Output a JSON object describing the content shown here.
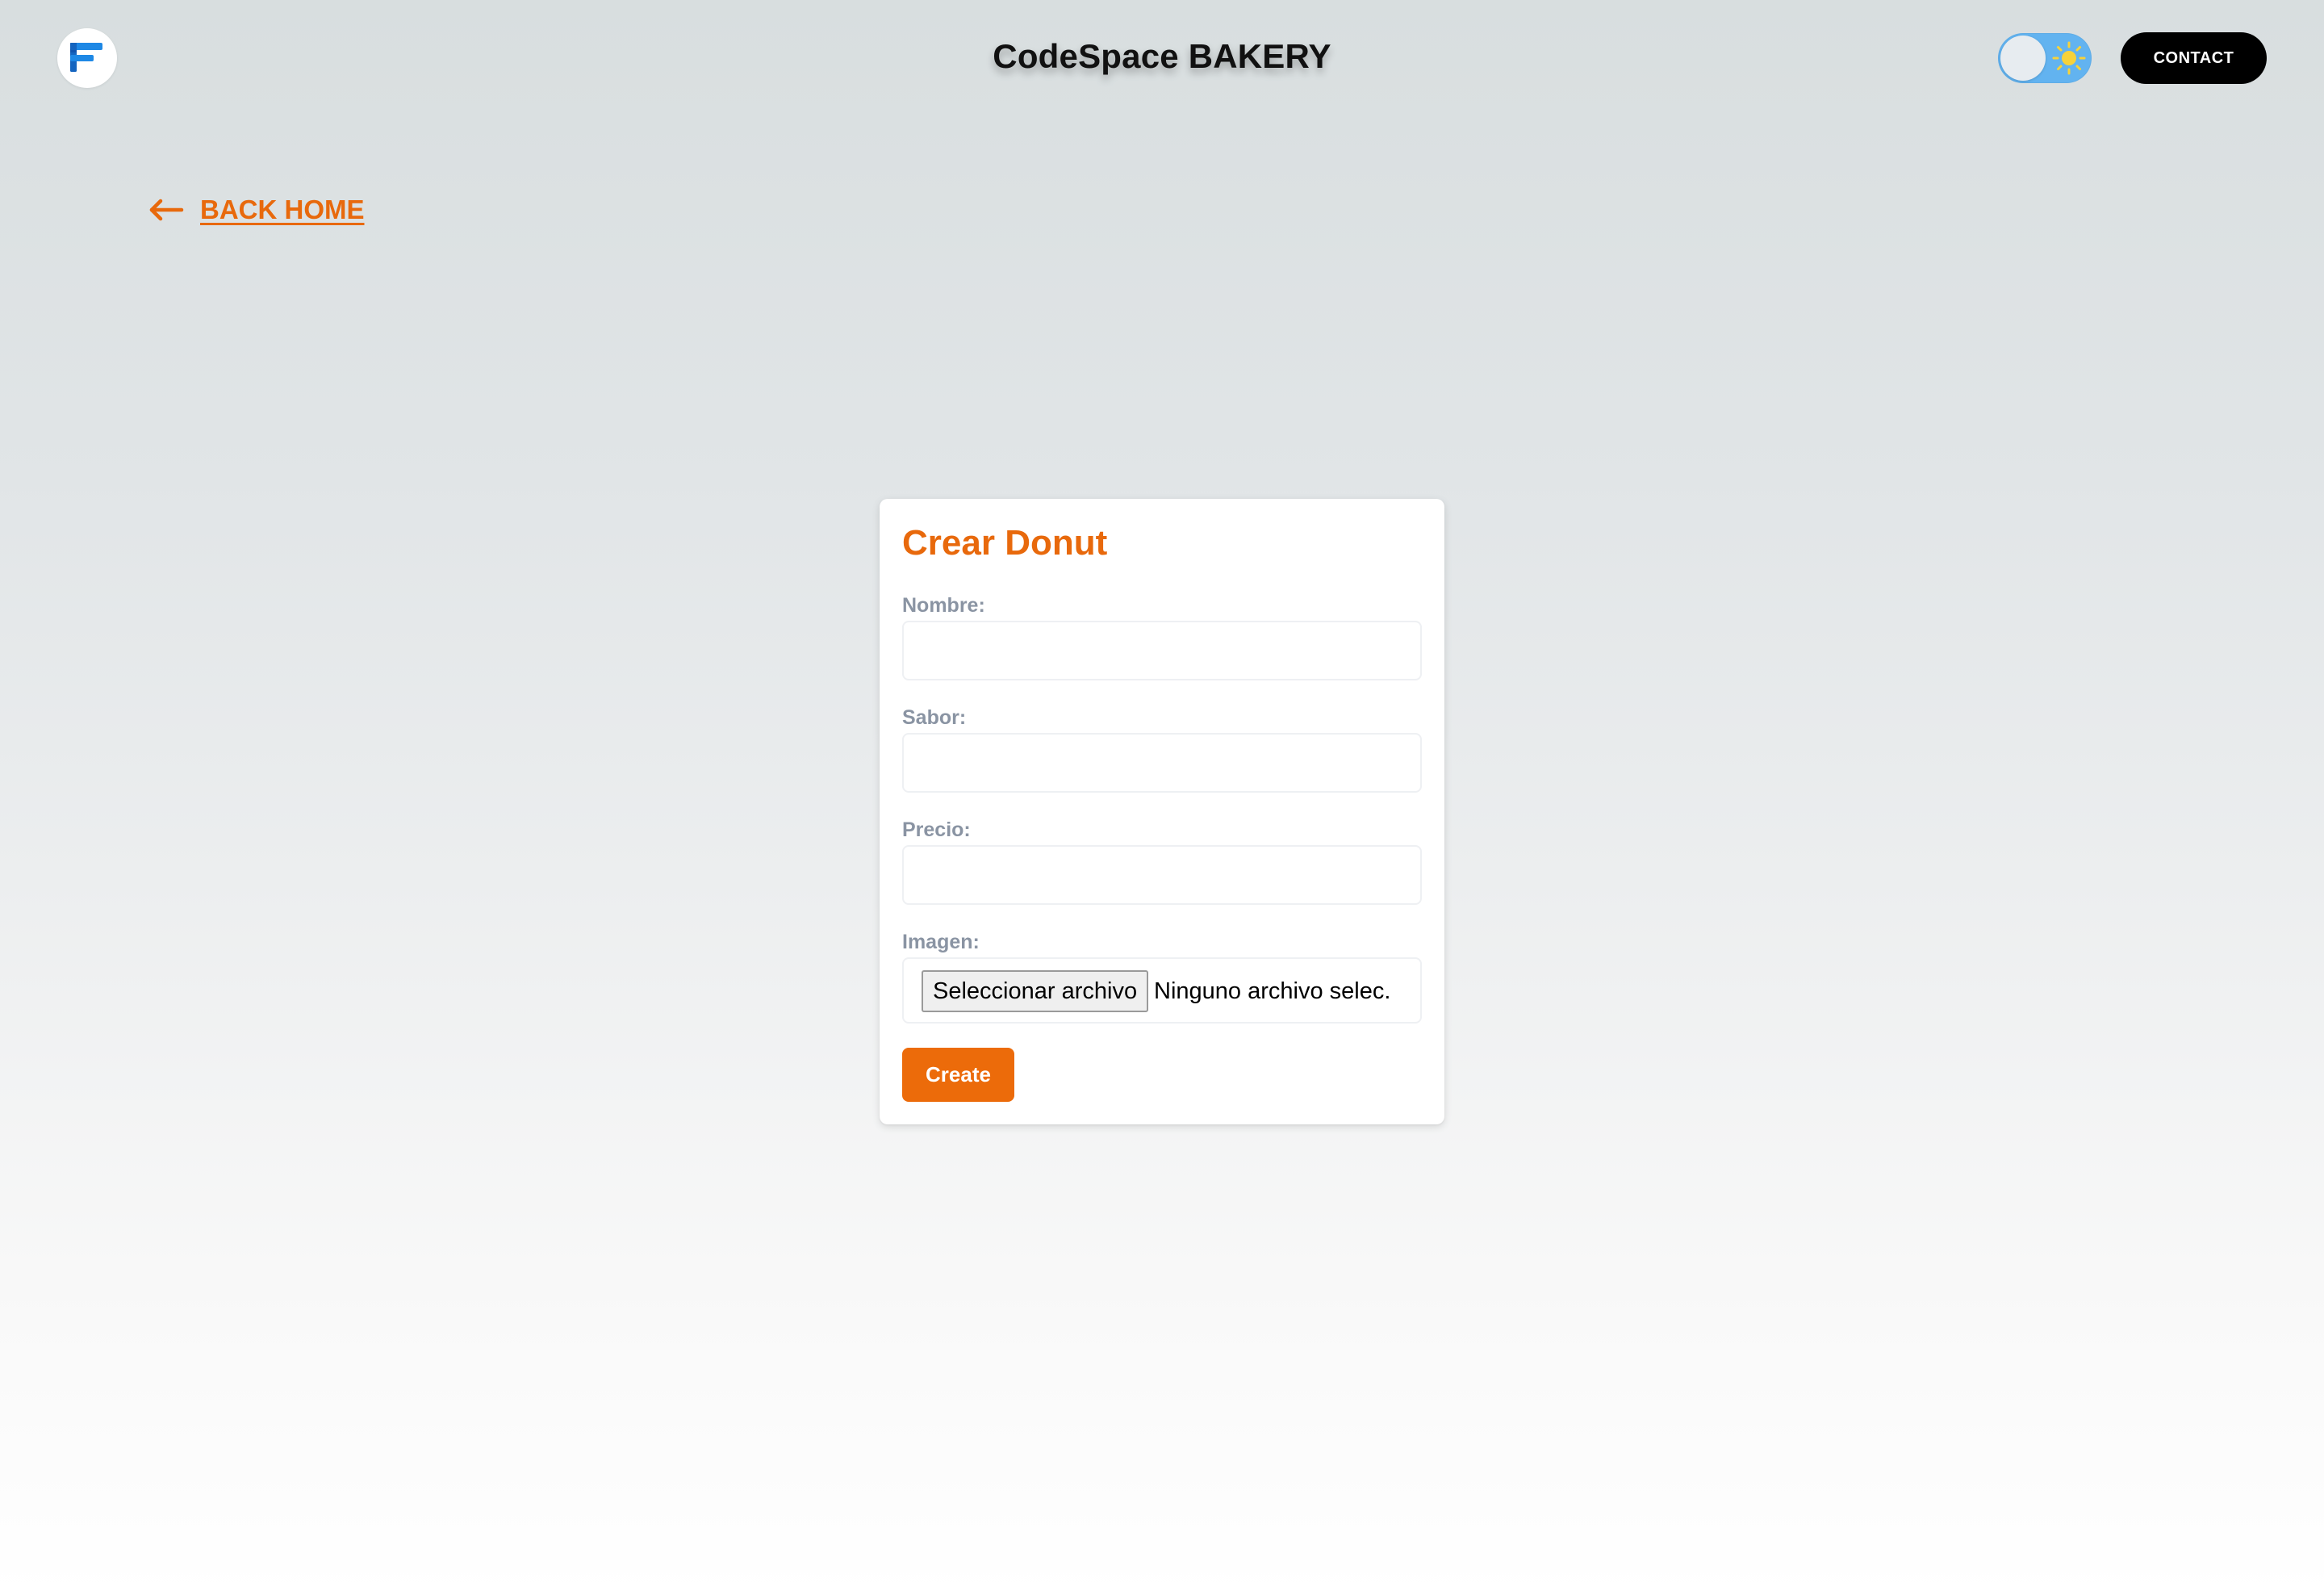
{
  "header": {
    "title": "CodeSpace BAKERY",
    "contact_label": "CONTACT",
    "theme_toggle": {
      "mode": "light",
      "icon": "sun-icon"
    },
    "logo_icon": "f-logo-icon"
  },
  "back_link": {
    "icon": "arrow-left-icon",
    "label": "BACK HOME"
  },
  "form": {
    "title": "Crear Donut",
    "fields": [
      {
        "label": "Nombre:",
        "value": "",
        "placeholder": ""
      },
      {
        "label": "Sabor:",
        "value": "",
        "placeholder": ""
      },
      {
        "label": "Precio:",
        "value": "",
        "placeholder": ""
      }
    ],
    "image": {
      "label": "Imagen:",
      "button_label": "Seleccionar archivo",
      "status": "Ninguno archivo selec."
    },
    "submit_label": "Create"
  },
  "colors": {
    "accent": "#e8690c",
    "toggle": "#62b3f0",
    "sun": "#f7d23a",
    "logo_blue": "#1b8be8"
  }
}
